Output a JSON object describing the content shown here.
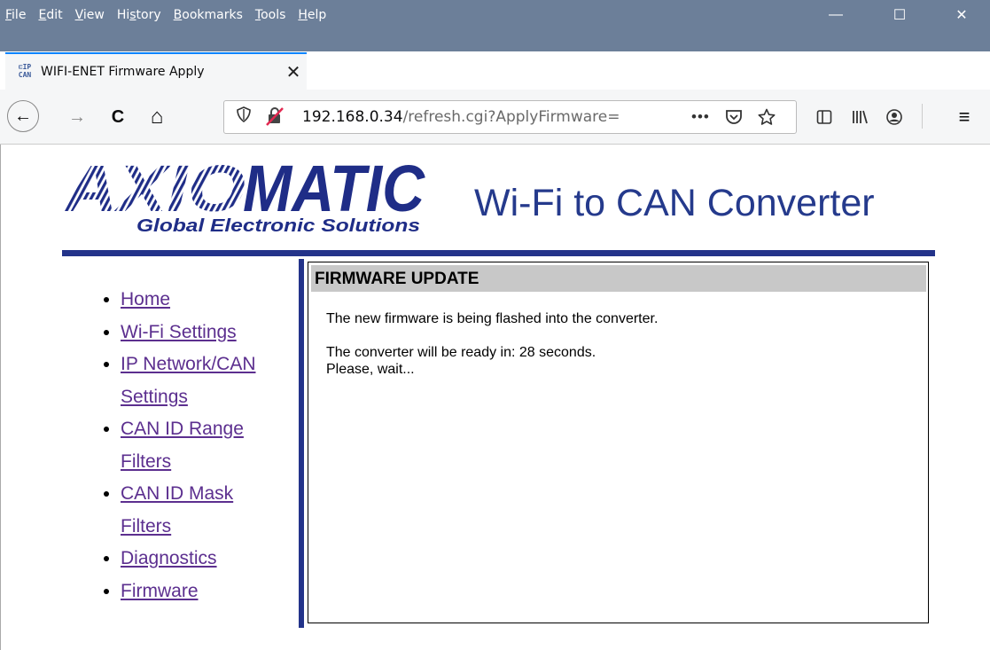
{
  "window": {
    "menu": [
      {
        "pre": "",
        "acc": "F",
        "post": "ile"
      },
      {
        "pre": "",
        "acc": "E",
        "post": "dit"
      },
      {
        "pre": "",
        "acc": "V",
        "post": "iew"
      },
      {
        "pre": "Hi",
        "acc": "s",
        "post": "tory"
      },
      {
        "pre": "",
        "acc": "B",
        "post": "ookmarks"
      },
      {
        "pre": "",
        "acc": "T",
        "post": "ools"
      },
      {
        "pre": "",
        "acc": "H",
        "post": "elp"
      }
    ],
    "controls": {
      "minimize": "—",
      "maximize": "☐",
      "close": "✕"
    }
  },
  "tab": {
    "icon_top": "⊏IP",
    "icon_bottom": "CAN",
    "title": "WIFI-ENET Firmware Apply",
    "close": "✕",
    "new_tab": "+"
  },
  "toolbar": {
    "back": "←",
    "forward": "→",
    "reload": "C",
    "home": "⌂",
    "url_host": "192.168.0.34",
    "url_path": "/refresh.cgi?ApplyFirmware=",
    "page_actions": "•••",
    "menu": "≡"
  },
  "page": {
    "logo_text": "AXIOMATIC",
    "logo_tagline": "Global Electronic Solutions",
    "heading": "Wi-Fi to CAN Converter",
    "nav": [
      "Home",
      "Wi-Fi Settings",
      "IP Network/CAN",
      "Settings",
      "CAN ID Range",
      "Filters",
      "CAN ID Mask",
      "Filters",
      "Diagnostics",
      "Firmware"
    ],
    "panel": {
      "title": "FIRMWARE UPDATE",
      "line1": "The new firmware is being flashed into the converter.",
      "line2": "The converter will be ready in: 28 seconds.",
      "line3": "Please, wait..."
    }
  },
  "colors": {
    "brand_blue": "#23338a",
    "heading_blue": "#253a8c",
    "link_visited": "#5c2f8f",
    "titlebar": "#6c7f99"
  }
}
